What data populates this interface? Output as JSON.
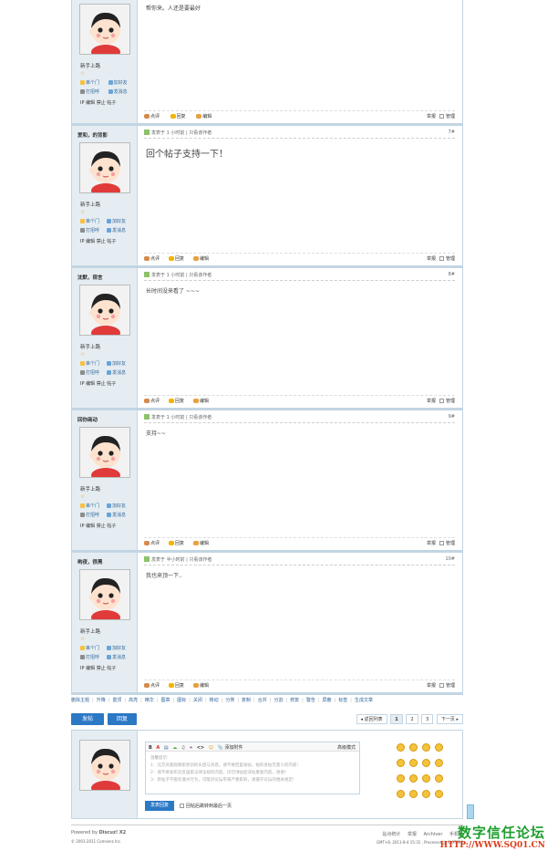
{
  "posts": [
    {
      "username": "",
      "time": "",
      "only_author": "",
      "floor": "",
      "content": "帮你来。人还是要最好",
      "big": false
    },
    {
      "username": "爱和，的背影",
      "time": "发表于 1 小时前",
      "only_author": "只看该作者",
      "floor": "7#",
      "content": "回个帖子支持一下！",
      "big": true
    },
    {
      "username": "沈默，宿言",
      "time": "发表于 1 小时前",
      "only_author": "只看该作者",
      "floor": "8#",
      "content": "长时间没来看了 ~~~",
      "big": false
    },
    {
      "username": "回你画动",
      "time": "发表于 1 小时前",
      "only_author": "只看该作者",
      "floor": "9#",
      "content": "支持~~",
      "big": false
    },
    {
      "username": "哟夜，很黑",
      "time": "发表于 半小时前",
      "only_author": "只看该作者",
      "floor": "10#",
      "content": "我也来顶一下..",
      "big": false
    }
  ],
  "user_panel": {
    "rank": "新手上路",
    "star": "☆",
    "btn_topic": "串个门",
    "btn_friend": "加好友",
    "btn_hello": "打招呼",
    "btn_msg": "发消息",
    "admin_ip": "IP",
    "admin_edit": "编辑",
    "admin_ban": "禁止",
    "admin_posts": "帖子"
  },
  "post_footer": {
    "rate": "点评",
    "reply": "回复",
    "edit": "编辑",
    "report": "举报",
    "manage": "管理"
  },
  "modbar": [
    "删除主题",
    "升降",
    "置顶",
    "高亮",
    "精华",
    "图章",
    "图标",
    "关闭",
    "移动",
    "分类",
    "复制",
    "合并",
    "分割",
    "修复",
    "警告",
    "屏蔽",
    "标签",
    "生成文章"
  ],
  "actions": {
    "post_btn": "发帖",
    "reply_btn": "回复",
    "back_list": "返回列表",
    "pages": [
      "1",
      "2",
      "3"
    ],
    "next": "下一页"
  },
  "reply_box": {
    "toolbar_items": [
      "B",
      "A",
      "▤",
      "☁",
      "♫",
      "«",
      "<>",
      "☺"
    ],
    "attach": "添加附件",
    "mode": "高级模式",
    "tips_title": "温馨提示:",
    "tip1": "1：北京凤凰观察家原创的乐团与消息，请不要回复发帖，拍的发帖无意义的内容!",
    "tip2": "2：请不要发布违反国家法律法规的内容，切勿顶帖后非帖重复内容，谢谢！",
    "tip3": "3：新帖子不能有灌水行为，可能对论坛带来严重影响，请遵守论坛的相关规定!",
    "submit": "发表回复",
    "jump_last": "回帖后跳转到最后一页"
  },
  "footer": {
    "powered": "Powered by",
    "brand": "Discuz! X2",
    "copyright": "© 2001-2011 Comsenz Inc.",
    "links": [
      "站点统计",
      "举报",
      "Archiver",
      "手机版"
    ],
    "version": "GMT+8, 2011-8-4 15:31 , Processed in 0.07898"
  },
  "watermark": {
    "line1": "数字信任论坛",
    "line2": "HTTP://WWW.SQ01.CN"
  }
}
